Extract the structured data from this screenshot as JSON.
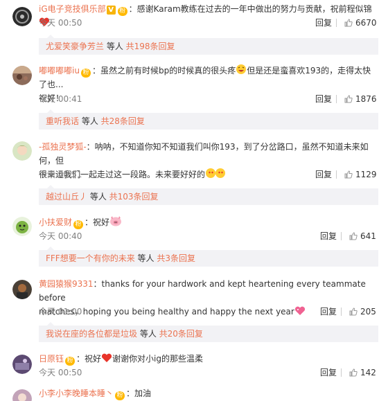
{
  "comments": [
    {
      "username": "iG电子竞技俱乐部",
      "text": "：感谢Karam教练在过去的一年中做出的努力与贡献，祝前程似锦",
      "time": "今天 00:50",
      "reply": "回复",
      "likes": "6670",
      "sub": {
        "name": "尤爱笑豪争芳兰",
        "mid": " 等人 ",
        "count": "共198条回复"
      }
    },
    {
      "username": "嘟嘟嘟嘟iu",
      "text": "：虽然之前有时候bp的时候真的很头疼",
      "text2": "但是还是蛮喜欢193的，走得太快了也...",
      "line2": "祝好！",
      "time": "今天 00:41",
      "reply": "回复",
      "likes": "1876",
      "sub": {
        "name": "重听我话",
        "mid": " 等人 ",
        "count": "共28条回复"
      }
    },
    {
      "username": "-孤独灵梦狐-",
      "text": "：呐呐，不知道你知不知道我们叫你193，到了分岔路口，虽然不知道未来如何，但",
      "line2": "很幸运我们一起走过这一段路。未来要好好的",
      "time": "今天 00:51",
      "reply": "回复",
      "likes": "1129",
      "sub": {
        "name": "越过山丘丿",
        "mid": " 等人 ",
        "count": "共103条回复"
      }
    },
    {
      "username": "小扶爱财",
      "text": "：祝好",
      "time": "今天 00:40",
      "reply": "回复",
      "likes": "641",
      "sub": {
        "name": "FFF想要一个有你的未来",
        "mid": " 等人 ",
        "count": "共3条回复"
      }
    },
    {
      "username": "黄园猿猴9331",
      "text": "：thanks for your hardwork and kept heartening  every teammate before",
      "line2": "matches，hoping you being healthy and happy the next year",
      "time": "今天 01:00",
      "reply": "回复",
      "likes": "205",
      "sub": {
        "name": "我说在座的各位都是垃圾",
        "mid": " 等人 ",
        "count": "共20条回复"
      }
    },
    {
      "username": "日原钰",
      "text": "：祝好",
      "text2": "谢谢你对小ig的那些温柔",
      "time": "今天 00:50",
      "reply": "回复",
      "likes": "142"
    },
    {
      "username": "小李小李晚睡本睡丶",
      "text": "：加油"
    }
  ],
  "badges": {
    "verified": "V",
    "fan": "粉"
  },
  "colors": {
    "username": "#eb7350",
    "subbox_bg": "#f2f2f5",
    "time": "#808080"
  },
  "icons": {
    "like": "thumbs-up-icon",
    "heart": "heart-icon"
  }
}
